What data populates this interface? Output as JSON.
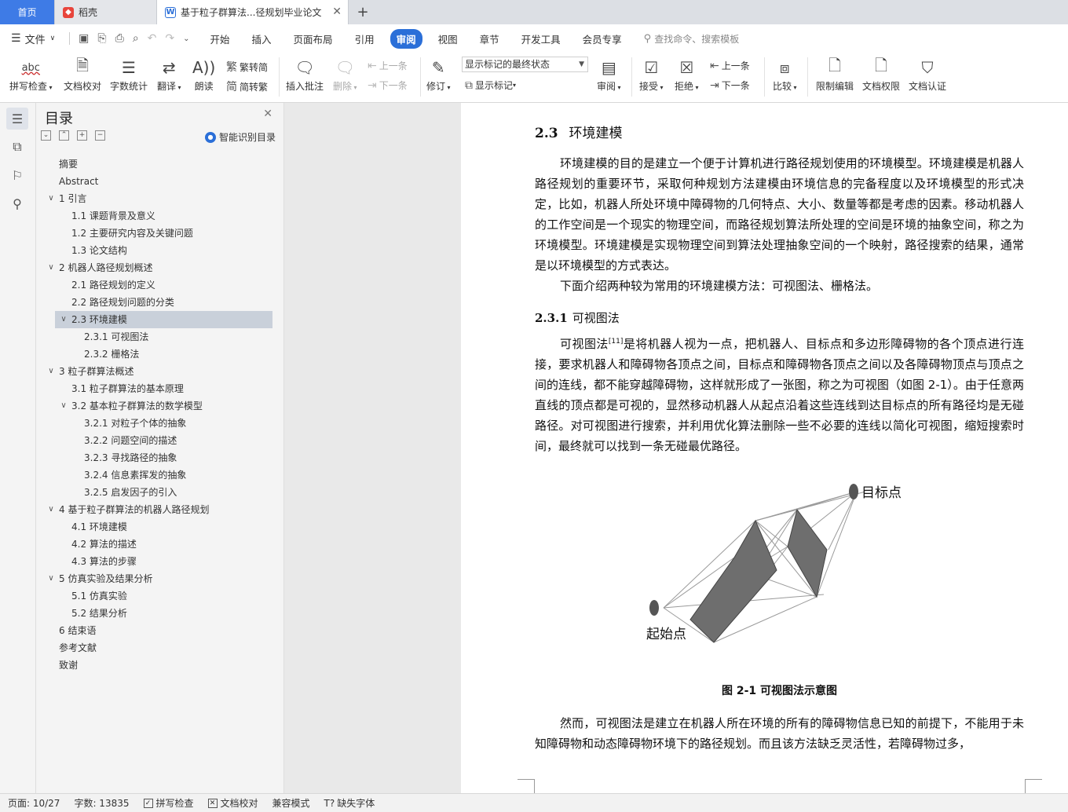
{
  "tabs": {
    "home": "首页",
    "daoke": "稻壳",
    "doc": "基于粒子群算法...径规划毕业论文"
  },
  "menu": {
    "file": "文件",
    "tabs": [
      "开始",
      "插入",
      "页面布局",
      "引用",
      "审阅",
      "视图",
      "章节",
      "开发工具",
      "会员专享"
    ],
    "active_tab": "审阅",
    "search_placeholder": "查找命令、搜索模板"
  },
  "ribbon": {
    "spell_check": "拼写检查",
    "spell_check_icon_text": "abc",
    "doc_proof": "文档校对",
    "word_count": "字数统计",
    "translate": "翻译",
    "read_aloud": "朗读",
    "trad_simp": "繁转简",
    "simp_trad": "简转繁",
    "insert_comment": "插入批注",
    "delete": "删除",
    "prev_comment": "上一条",
    "next_comment": "下一条",
    "revise": "修订",
    "markup_mode": "显示标记的最终状态",
    "show_markup": "显示标记",
    "review": "审阅",
    "accept": "接受",
    "reject": "拒绝",
    "prev_change": "上一条",
    "next_change": "下一条",
    "compare": "比较",
    "restrict_edit": "限制编辑",
    "doc_permission": "文档权限",
    "doc_certify": "文档认证"
  },
  "toc": {
    "title": "目录",
    "smart_label": "智能识别目录",
    "items": [
      {
        "text": "摘要",
        "level": 0,
        "chev": ""
      },
      {
        "text": "Abstract",
        "level": 0,
        "chev": ""
      },
      {
        "text": "1 引言",
        "level": 0,
        "chev": "v"
      },
      {
        "text": "1.1 课题背景及意义",
        "level": 1,
        "chev": ""
      },
      {
        "text": "1.2 主要研究内容及关键问题",
        "level": 1,
        "chev": ""
      },
      {
        "text": "1.3 论文结构",
        "level": 1,
        "chev": ""
      },
      {
        "text": "2 机器人路径规划概述",
        "level": 0,
        "chev": "v"
      },
      {
        "text": "2.1 路径规划的定义",
        "level": 1,
        "chev": ""
      },
      {
        "text": "2.2 路径规划问题的分类",
        "level": 1,
        "chev": ""
      },
      {
        "text": "2.3 环境建模",
        "level": 1,
        "chev": "v",
        "active": true
      },
      {
        "text": "2.3.1 可视图法",
        "level": 2,
        "chev": ""
      },
      {
        "text": "2.3.2 栅格法",
        "level": 2,
        "chev": ""
      },
      {
        "text": "3 粒子群算法概述",
        "level": 0,
        "chev": "v"
      },
      {
        "text": "3.1 粒子群算法的基本原理",
        "level": 1,
        "chev": ""
      },
      {
        "text": "3.2 基本粒子群算法的数学模型",
        "level": 1,
        "chev": "v"
      },
      {
        "text": "3.2.1 对粒子个体的抽象",
        "level": 2,
        "chev": ""
      },
      {
        "text": "3.2.2 问题空间的描述",
        "level": 2,
        "chev": ""
      },
      {
        "text": "3.2.3 寻找路径的抽象",
        "level": 2,
        "chev": ""
      },
      {
        "text": "3.2.4 信息素挥发的抽象",
        "level": 2,
        "chev": ""
      },
      {
        "text": "3.2.5 启发因子的引入",
        "level": 2,
        "chev": ""
      },
      {
        "text": "4 基于粒子群算法的机器人路径规划",
        "level": 0,
        "chev": "v"
      },
      {
        "text": "4.1 环境建模",
        "level": 1,
        "chev": ""
      },
      {
        "text": "4.2 算法的描述",
        "level": 1,
        "chev": ""
      },
      {
        "text": "4.3 算法的步骤",
        "level": 1,
        "chev": ""
      },
      {
        "text": "5 仿真实验及结果分析",
        "level": 0,
        "chev": "v"
      },
      {
        "text": "5.1 仿真实验",
        "level": 1,
        "chev": ""
      },
      {
        "text": "5.2 结果分析",
        "level": 1,
        "chev": ""
      },
      {
        "text": "6 结束语",
        "level": 0,
        "chev": ""
      },
      {
        "text": "参考文献",
        "level": 0,
        "chev": ""
      },
      {
        "text": "致谢",
        "level": 0,
        "chev": ""
      }
    ]
  },
  "doc": {
    "h2_num": "2.3",
    "h2_text": "环境建模",
    "p1": "环境建模的目的是建立一个便于计算机进行路径规划使用的环境模型。环境建模是机器人路径规划的重要环节，采取何种规划方法建模由环境信息的完备程度以及环境模型的形式决定，比如，机器人所处环境中障碍物的几何特点、大小、数量等都是考虑的因素。移动机器人的工作空间是一个现实的物理空间，而路径规划算法所处理的空间是环境的抽象空间，称之为环境模型。环境建模是实现物理空间到算法处理抽象空间的一个映射，路径搜索的结果，通常是以环境模型的方式表达。",
    "p2": "下面介绍两种较为常用的环境建模方法：可视图法、栅格法。",
    "h3_num": "2.3.1",
    "h3_text": "可视图法",
    "p3_a": "可视图法",
    "p3_ref": "[11]",
    "p3_b": "是将机器人视为一点，把机器人、目标点和多边形障碍物的各个顶点进行连接，要求机器人和障碍物各顶点之间，目标点和障碍物各顶点之间以及各障碍物顶点与顶点之间的连线，都不能穿越障碍物，这样就形成了一张图，称之为可视图（如图 2-1）。由于任意两直线的顶点都是可视的，显然移动机器人从起点沿着这些连线到达目标点的所有路径均是无碰路径。对可视图进行搜索，并利用优化算法删除一些不必要的连线以简化可视图，缩短搜索时间，最终就可以找到一条无碰最优路径。",
    "fig_goal": "目标点",
    "fig_start": "起始点",
    "caption": "图 2-1  可视图法示意图",
    "p4": "然而，可视图法是建立在机器人所在环境的所有的障碍物信息已知的前提下，不能用于未知障碍物和动态障碍物环境下的路径规划。而且该方法缺乏灵活性，若障碍物过多，"
  },
  "status": {
    "page": "页面: 10/27",
    "words": "字数: 13835",
    "spell": "拼写检查",
    "proof": "文档校对",
    "compat": "兼容模式",
    "missing_font": "缺失字体"
  },
  "colors": {
    "accent": "#2b6fd8",
    "home_tab": "#3e7be6",
    "obstacle": "#6e6e6e"
  }
}
